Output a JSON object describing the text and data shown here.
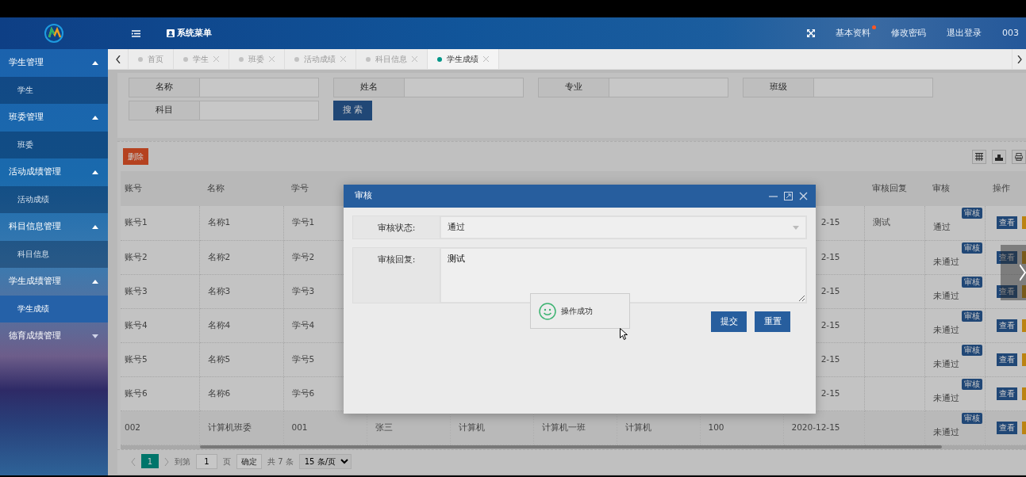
{
  "header": {
    "title": "系统菜单",
    "links": [
      {
        "label": "基本资料",
        "dot": true
      },
      {
        "label": "修改密码",
        "dot": false
      },
      {
        "label": "退出登录",
        "dot": false
      }
    ],
    "user": "003"
  },
  "sidebar": {
    "items": [
      {
        "label": "学生管理",
        "expanded": true,
        "children": [
          {
            "label": "学生",
            "selected": false
          }
        ]
      },
      {
        "label": "班委管理",
        "expanded": true,
        "children": [
          {
            "label": "班委",
            "selected": false
          }
        ]
      },
      {
        "label": "活动成绩管理",
        "expanded": true,
        "children": [
          {
            "label": "活动成绩",
            "selected": false
          }
        ]
      },
      {
        "label": "科目信息管理",
        "expanded": true,
        "children": [
          {
            "label": "科目信息",
            "selected": false
          }
        ]
      },
      {
        "label": "学生成绩管理",
        "expanded": true,
        "children": [
          {
            "label": "学生成绩",
            "selected": true
          }
        ]
      },
      {
        "label": "德育成绩管理",
        "expanded": false
      }
    ]
  },
  "tabs": [
    {
      "label": "首页",
      "closable": false,
      "selected": false
    },
    {
      "label": "学生",
      "closable": true,
      "selected": false
    },
    {
      "label": "班委",
      "closable": true,
      "selected": false
    },
    {
      "label": "活动成绩",
      "closable": true,
      "selected": false
    },
    {
      "label": "科目信息",
      "closable": true,
      "selected": false
    },
    {
      "label": "学生成绩",
      "closable": true,
      "selected": true
    }
  ],
  "search": {
    "fields": [
      {
        "label": "名称"
      },
      {
        "label": "姓名"
      },
      {
        "label": "专业"
      },
      {
        "label": "班级"
      },
      {
        "label": "科目"
      }
    ],
    "button": "搜 索"
  },
  "toolbar": {
    "delete_button": "删除"
  },
  "table": {
    "columns": [
      "账号",
      "名称",
      "学号",
      null,
      null,
      null,
      null,
      null,
      null,
      "审核回复",
      "审核",
      "操作"
    ],
    "rows": [
      {
        "cells": [
          "账号1",
          "名称1",
          "学号1",
          null,
          null,
          null,
          null,
          null,
          "2-15",
          "测试"
        ],
        "audit_status": "通过",
        "audit_button": "审核",
        "view_button": "查看"
      },
      {
        "cells": [
          "账号2",
          "名称2",
          "学号2",
          null,
          null,
          null,
          null,
          null,
          "2-15",
          null
        ],
        "audit_status": "未通过",
        "audit_button": "审核",
        "view_button": "查看"
      },
      {
        "cells": [
          "账号3",
          "名称3",
          "学号3",
          null,
          null,
          null,
          null,
          null,
          "2-15",
          null
        ],
        "audit_status": "未通过",
        "audit_button": "审核",
        "view_button": "查看"
      },
      {
        "cells": [
          "账号4",
          "名称4",
          "学号4",
          null,
          null,
          null,
          null,
          null,
          "2-15",
          null
        ],
        "audit_status": "未通过",
        "audit_button": "审核",
        "view_button": "查看"
      },
      {
        "cells": [
          "账号5",
          "名称5",
          "学号5",
          null,
          null,
          null,
          null,
          null,
          "2-15",
          null
        ],
        "audit_status": "未通过",
        "audit_button": "审核",
        "view_button": "查看"
      },
      {
        "cells": [
          "账号6",
          "名称6",
          "学号6",
          null,
          null,
          null,
          null,
          null,
          "2-15",
          null
        ],
        "audit_status": "未通过",
        "audit_button": "审核",
        "view_button": "查看"
      },
      {
        "cells": [
          "002",
          "计算机班委",
          "001",
          "张三",
          "计算机",
          "计算机一班",
          "计算机",
          "100",
          "2020-12-15",
          null
        ],
        "audit_status": "未通过",
        "audit_button": "审核",
        "view_button": "查看"
      }
    ]
  },
  "pagination": {
    "page": "1",
    "goto_label": "到第",
    "goto_value": "1",
    "page_unit": "页",
    "confirm": "确定",
    "total": "共 7 条",
    "page_size": "15 条/页"
  },
  "dialog": {
    "title": "审核",
    "fields": [
      {
        "kind": "select",
        "label": "审核状态:",
        "value": "通过"
      },
      {
        "kind": "textarea",
        "label": "审核回复:",
        "value": "测试"
      }
    ],
    "buttons": [
      "提交",
      "重置"
    ]
  },
  "toast": {
    "message": "操作成功"
  }
}
